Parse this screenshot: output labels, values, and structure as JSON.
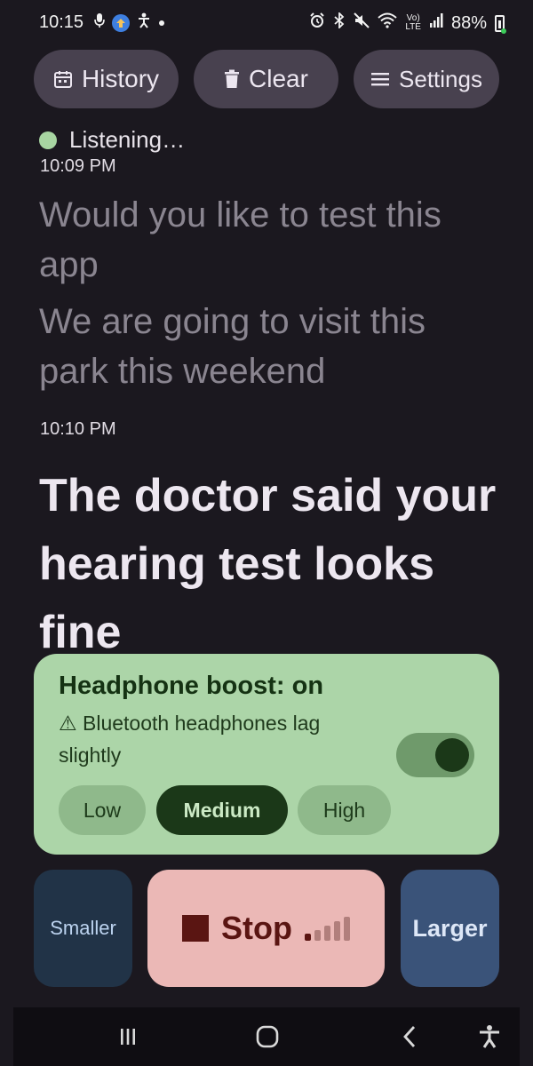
{
  "status_bar": {
    "time": "10:15",
    "battery": "88%",
    "left_icons": [
      "mic-icon",
      "upload-badge-icon",
      "accessibility-person-icon",
      "dot-icon"
    ],
    "right_icons": [
      "alarm-icon",
      "bluetooth-icon",
      "mute-icon",
      "wifi-icon",
      "volte-icon",
      "signal-icon",
      "battery-icon"
    ]
  },
  "toolbar": {
    "history_label": "History",
    "clear_label": "Clear",
    "settings_label": "Settings"
  },
  "transcript": {
    "status": "Listening…",
    "groups": [
      {
        "time": "10:09 PM",
        "lines": [
          "Would you like to test this app",
          "We are going to visit this park this weekend"
        ]
      },
      {
        "time": "10:10 PM",
        "lines": [
          "The doctor said your hearing test looks fine"
        ]
      }
    ]
  },
  "boost": {
    "title": "Headphone boost: on",
    "warning": "⚠ Bluetooth headphones lag slightly",
    "enabled": true,
    "levels": [
      "Low",
      "Medium",
      "High"
    ],
    "selected": "Medium"
  },
  "controls": {
    "smaller_label": "Smaller",
    "stop_label": "Stop",
    "larger_label": "Larger",
    "audio_level_bars_active": 1,
    "audio_level_bars_total": 5
  },
  "colors": {
    "background": "#1b181f",
    "pill": "#48414f",
    "listening_dot": "#a8d5a2",
    "boost_card": "#acd5a8",
    "stop_button": "#ebb8b6",
    "smaller_button": "#213347",
    "larger_button": "#3a5379"
  },
  "nav_bar": {
    "icons": [
      "recent-apps-icon",
      "home-icon",
      "back-icon",
      "accessibility-icon"
    ]
  }
}
